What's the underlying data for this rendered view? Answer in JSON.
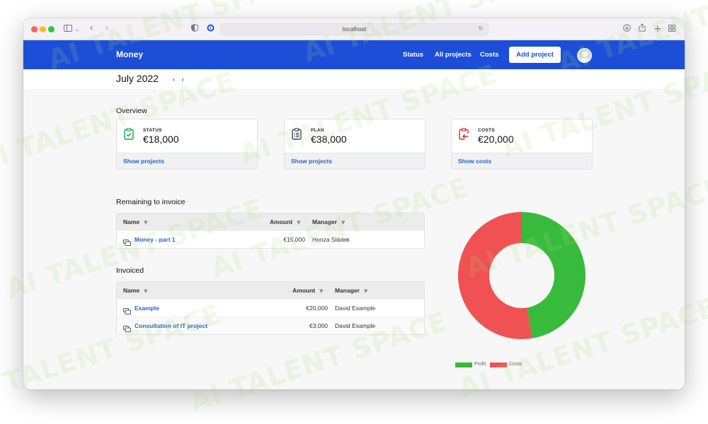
{
  "browser": {
    "url": "localhost"
  },
  "navbar": {
    "brand": "Money",
    "links": [
      "Status",
      "All projects",
      "Costs"
    ],
    "add_project": "Add project"
  },
  "month": {
    "title": "July 2022",
    "prev": "‹",
    "next": "›"
  },
  "overview": {
    "title": "Overview",
    "cards": [
      {
        "label": "STATUS",
        "value": "€18,000",
        "link": "Show projects",
        "icon": "clipboard-check-icon",
        "color": "#16a34a"
      },
      {
        "label": "PLAN",
        "value": "€38,000",
        "link": "Show projects",
        "icon": "clipboard-list-icon",
        "color": "#374151"
      },
      {
        "label": "COSTS",
        "value": "€20,000",
        "link": "Show costs",
        "icon": "clipboard-arrow-icon",
        "color": "#dc2626"
      }
    ]
  },
  "remaining": {
    "title": "Remaining to invoice",
    "headers": {
      "name": "Name",
      "amount": "Amount",
      "manager": "Manager"
    },
    "rows": [
      {
        "name": "Money - part 1",
        "amount": "€15,000",
        "manager": "Honza Sládek"
      }
    ]
  },
  "invoiced": {
    "title": "Invoiced",
    "headers": {
      "name": "Name",
      "amount": "Amount",
      "manager": "Manager"
    },
    "rows": [
      {
        "name": "Example",
        "amount": "€20,000",
        "manager": "David Example"
      },
      {
        "name": "Consultation of IT project",
        "amount": "€3,000",
        "manager": "David Example"
      }
    ]
  },
  "chart_data": {
    "type": "pie",
    "categories": [
      "Profit",
      "Costs"
    ],
    "values": [
      18000,
      20000
    ],
    "colors": [
      "#38bb3c",
      "#f05254"
    ],
    "legend": "bottom"
  },
  "watermark": "AI TALENT SPACE"
}
